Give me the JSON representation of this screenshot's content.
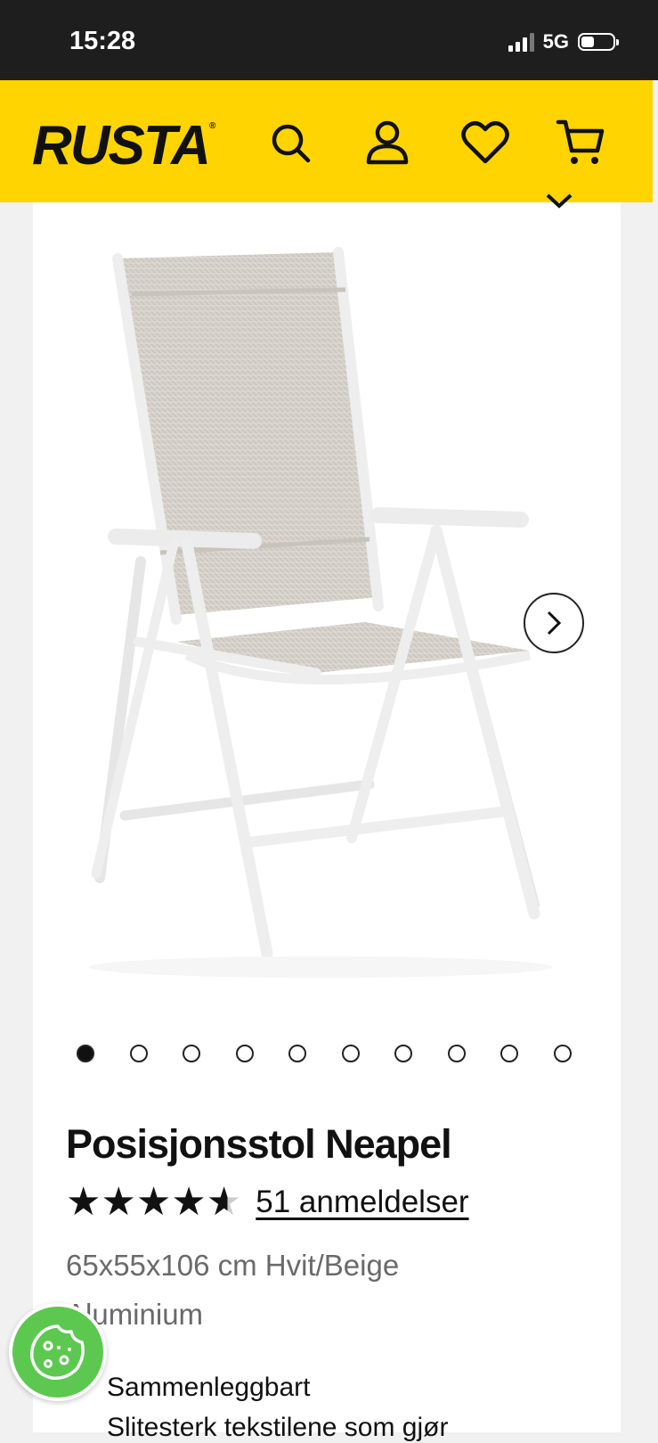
{
  "status_bar": {
    "time": "15:28",
    "network": "5G"
  },
  "header": {
    "logo": "RUSTA",
    "icons": [
      "search-icon",
      "account-icon",
      "heart-icon",
      "cart-icon"
    ],
    "brand_color": "#ffd400"
  },
  "gallery": {
    "image_count": 10,
    "active_index": 0
  },
  "product": {
    "title": "Posisjonsstol Neapel",
    "rating": 4.6,
    "reviews_label": "51 anmeldelser",
    "description": "65x55x106 cm Hvit/Beige Aluminium",
    "features": [
      "Sammenleggbart",
      "Slitesterk tekstilene som gjør"
    ]
  }
}
